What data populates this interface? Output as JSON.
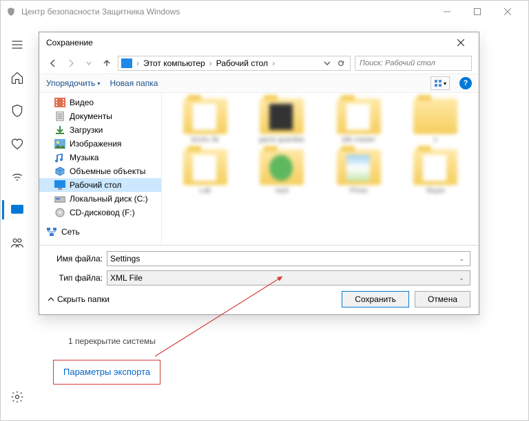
{
  "app": {
    "title": "Центр безопасности Защитника Windows"
  },
  "sidebar": {
    "items": [
      "menu",
      "home",
      "shield",
      "heart",
      "wifi",
      "monitor",
      "family"
    ]
  },
  "main": {
    "overlap_text": "1 перекрытие системы",
    "export_link": "Параметры экспорта"
  },
  "dialog": {
    "title": "Сохранение",
    "breadcrumb": {
      "root": "Этот компьютер",
      "current": "Рабочий стол"
    },
    "search_placeholder": "Поиск: Рабочий стол",
    "toolbar": {
      "organize": "Упорядочить",
      "new_folder": "Новая папка"
    },
    "tree": [
      {
        "name": "Видео",
        "icon": "video"
      },
      {
        "name": "Документы",
        "icon": "doc"
      },
      {
        "name": "Загрузки",
        "icon": "download"
      },
      {
        "name": "Изображения",
        "icon": "image"
      },
      {
        "name": "Музыка",
        "icon": "music"
      },
      {
        "name": "Объемные объекты",
        "icon": "3d"
      },
      {
        "name": "Рабочий стол",
        "icon": "desktop",
        "selected": true
      },
      {
        "name": "Локальный диск (C:)",
        "icon": "disk"
      },
      {
        "name": "CD-дисковод (F:)",
        "icon": "cd"
      }
    ],
    "network_label": "Сеть",
    "files": [
      {
        "label": "bricks 3k",
        "v": "plain"
      },
      {
        "label": "game guardian",
        "v": "dark"
      },
      {
        "label": "idle master",
        "v": "plain"
      },
      {
        "label": "x",
        "v": "plain"
      },
      {
        "label": "Lab",
        "v": "plain"
      },
      {
        "label": "mp3",
        "v": "green"
      },
      {
        "label": "Photo",
        "v": "photo"
      },
      {
        "label": "Skype",
        "v": "plain"
      }
    ],
    "filename_label": "Имя файла:",
    "filetype_label": "Тип файла:",
    "filename_value": "Settings",
    "filetype_value": "XML File",
    "hide_folders": "Скрыть папки",
    "save_btn": "Сохранить",
    "cancel_btn": "Отмена",
    "help": "?"
  }
}
